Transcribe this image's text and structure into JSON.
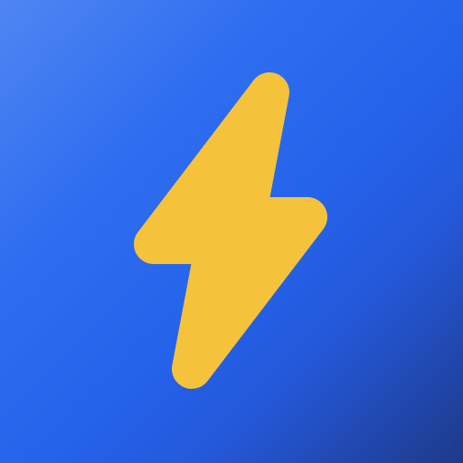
{
  "icon": {
    "name": "lightning-bolt-icon",
    "colors": {
      "background_start": "#4f86f2",
      "background_mid": "#2563eb",
      "background_end": "#1e3a8a",
      "bolt": "#f5c33b"
    }
  }
}
